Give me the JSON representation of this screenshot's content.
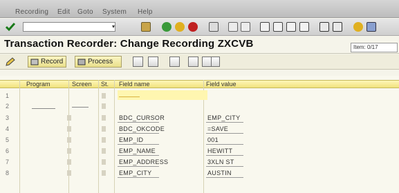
{
  "menu": [
    "Recording",
    "Edit",
    "Goto",
    "System",
    "Help"
  ],
  "toolbar": {
    "command_value": "",
    "icons": [
      "check-icon",
      "save-icon",
      "back-icon",
      "exit-icon",
      "cancel-icon",
      "print-icon",
      "find-icon",
      "find-next-icon",
      "first-page-icon",
      "prev-page-icon",
      "next-page-icon",
      "last-page-icon",
      "new-session-icon",
      "shortcut-icon",
      "help-icon",
      "layout-icon"
    ]
  },
  "title": "Transaction Recorder: Change Recording ZXCVB",
  "item_field": "Item: 0/17",
  "app_toolbar": {
    "record_label": "Record",
    "process_label": "Process"
  },
  "table": {
    "headers": [
      "Program",
      "Screen",
      "St.",
      "Field name",
      "Field value"
    ],
    "rows": [
      {
        "num": "1",
        "field": "",
        "value": ""
      },
      {
        "num": "2",
        "field": "",
        "value": ""
      },
      {
        "num": "3",
        "field": "BDC_CURSOR",
        "value": "EMP_CITY"
      },
      {
        "num": "4",
        "field": "BDC_OKCODE",
        "value": "=SAVE"
      },
      {
        "num": "5",
        "field": "EMP_ID",
        "value": "001"
      },
      {
        "num": "6",
        "field": "EMP_NAME",
        "value": "HEWITT"
      },
      {
        "num": "7",
        "field": "EMP_ADDRESS",
        "value": "3XLN ST"
      },
      {
        "num": "8",
        "field": "EMP_CITY",
        "value": "AUSTIN"
      }
    ]
  }
}
